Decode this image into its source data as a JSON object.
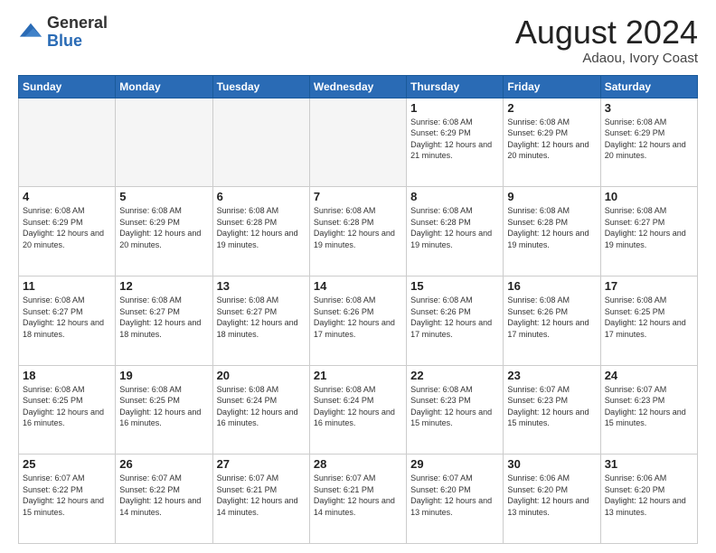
{
  "header": {
    "logo_general": "General",
    "logo_blue": "Blue",
    "month_title": "August 2024",
    "location": "Adaou, Ivory Coast"
  },
  "weekdays": [
    "Sunday",
    "Monday",
    "Tuesday",
    "Wednesday",
    "Thursday",
    "Friday",
    "Saturday"
  ],
  "weeks": [
    [
      {
        "day": "",
        "info": ""
      },
      {
        "day": "",
        "info": ""
      },
      {
        "day": "",
        "info": ""
      },
      {
        "day": "",
        "info": ""
      },
      {
        "day": "1",
        "info": "Sunrise: 6:08 AM\nSunset: 6:29 PM\nDaylight: 12 hours and 21 minutes."
      },
      {
        "day": "2",
        "info": "Sunrise: 6:08 AM\nSunset: 6:29 PM\nDaylight: 12 hours and 20 minutes."
      },
      {
        "day": "3",
        "info": "Sunrise: 6:08 AM\nSunset: 6:29 PM\nDaylight: 12 hours and 20 minutes."
      }
    ],
    [
      {
        "day": "4",
        "info": "Sunrise: 6:08 AM\nSunset: 6:29 PM\nDaylight: 12 hours and 20 minutes."
      },
      {
        "day": "5",
        "info": "Sunrise: 6:08 AM\nSunset: 6:29 PM\nDaylight: 12 hours and 20 minutes."
      },
      {
        "day": "6",
        "info": "Sunrise: 6:08 AM\nSunset: 6:28 PM\nDaylight: 12 hours and 19 minutes."
      },
      {
        "day": "7",
        "info": "Sunrise: 6:08 AM\nSunset: 6:28 PM\nDaylight: 12 hours and 19 minutes."
      },
      {
        "day": "8",
        "info": "Sunrise: 6:08 AM\nSunset: 6:28 PM\nDaylight: 12 hours and 19 minutes."
      },
      {
        "day": "9",
        "info": "Sunrise: 6:08 AM\nSunset: 6:28 PM\nDaylight: 12 hours and 19 minutes."
      },
      {
        "day": "10",
        "info": "Sunrise: 6:08 AM\nSunset: 6:27 PM\nDaylight: 12 hours and 19 minutes."
      }
    ],
    [
      {
        "day": "11",
        "info": "Sunrise: 6:08 AM\nSunset: 6:27 PM\nDaylight: 12 hours and 18 minutes."
      },
      {
        "day": "12",
        "info": "Sunrise: 6:08 AM\nSunset: 6:27 PM\nDaylight: 12 hours and 18 minutes."
      },
      {
        "day": "13",
        "info": "Sunrise: 6:08 AM\nSunset: 6:27 PM\nDaylight: 12 hours and 18 minutes."
      },
      {
        "day": "14",
        "info": "Sunrise: 6:08 AM\nSunset: 6:26 PM\nDaylight: 12 hours and 17 minutes."
      },
      {
        "day": "15",
        "info": "Sunrise: 6:08 AM\nSunset: 6:26 PM\nDaylight: 12 hours and 17 minutes."
      },
      {
        "day": "16",
        "info": "Sunrise: 6:08 AM\nSunset: 6:26 PM\nDaylight: 12 hours and 17 minutes."
      },
      {
        "day": "17",
        "info": "Sunrise: 6:08 AM\nSunset: 6:25 PM\nDaylight: 12 hours and 17 minutes."
      }
    ],
    [
      {
        "day": "18",
        "info": "Sunrise: 6:08 AM\nSunset: 6:25 PM\nDaylight: 12 hours and 16 minutes."
      },
      {
        "day": "19",
        "info": "Sunrise: 6:08 AM\nSunset: 6:25 PM\nDaylight: 12 hours and 16 minutes."
      },
      {
        "day": "20",
        "info": "Sunrise: 6:08 AM\nSunset: 6:24 PM\nDaylight: 12 hours and 16 minutes."
      },
      {
        "day": "21",
        "info": "Sunrise: 6:08 AM\nSunset: 6:24 PM\nDaylight: 12 hours and 16 minutes."
      },
      {
        "day": "22",
        "info": "Sunrise: 6:08 AM\nSunset: 6:23 PM\nDaylight: 12 hours and 15 minutes."
      },
      {
        "day": "23",
        "info": "Sunrise: 6:07 AM\nSunset: 6:23 PM\nDaylight: 12 hours and 15 minutes."
      },
      {
        "day": "24",
        "info": "Sunrise: 6:07 AM\nSunset: 6:23 PM\nDaylight: 12 hours and 15 minutes."
      }
    ],
    [
      {
        "day": "25",
        "info": "Sunrise: 6:07 AM\nSunset: 6:22 PM\nDaylight: 12 hours and 15 minutes."
      },
      {
        "day": "26",
        "info": "Sunrise: 6:07 AM\nSunset: 6:22 PM\nDaylight: 12 hours and 14 minutes."
      },
      {
        "day": "27",
        "info": "Sunrise: 6:07 AM\nSunset: 6:21 PM\nDaylight: 12 hours and 14 minutes."
      },
      {
        "day": "28",
        "info": "Sunrise: 6:07 AM\nSunset: 6:21 PM\nDaylight: 12 hours and 14 minutes."
      },
      {
        "day": "29",
        "info": "Sunrise: 6:07 AM\nSunset: 6:20 PM\nDaylight: 12 hours and 13 minutes."
      },
      {
        "day": "30",
        "info": "Sunrise: 6:06 AM\nSunset: 6:20 PM\nDaylight: 12 hours and 13 minutes."
      },
      {
        "day": "31",
        "info": "Sunrise: 6:06 AM\nSunset: 6:20 PM\nDaylight: 12 hours and 13 minutes."
      }
    ]
  ]
}
